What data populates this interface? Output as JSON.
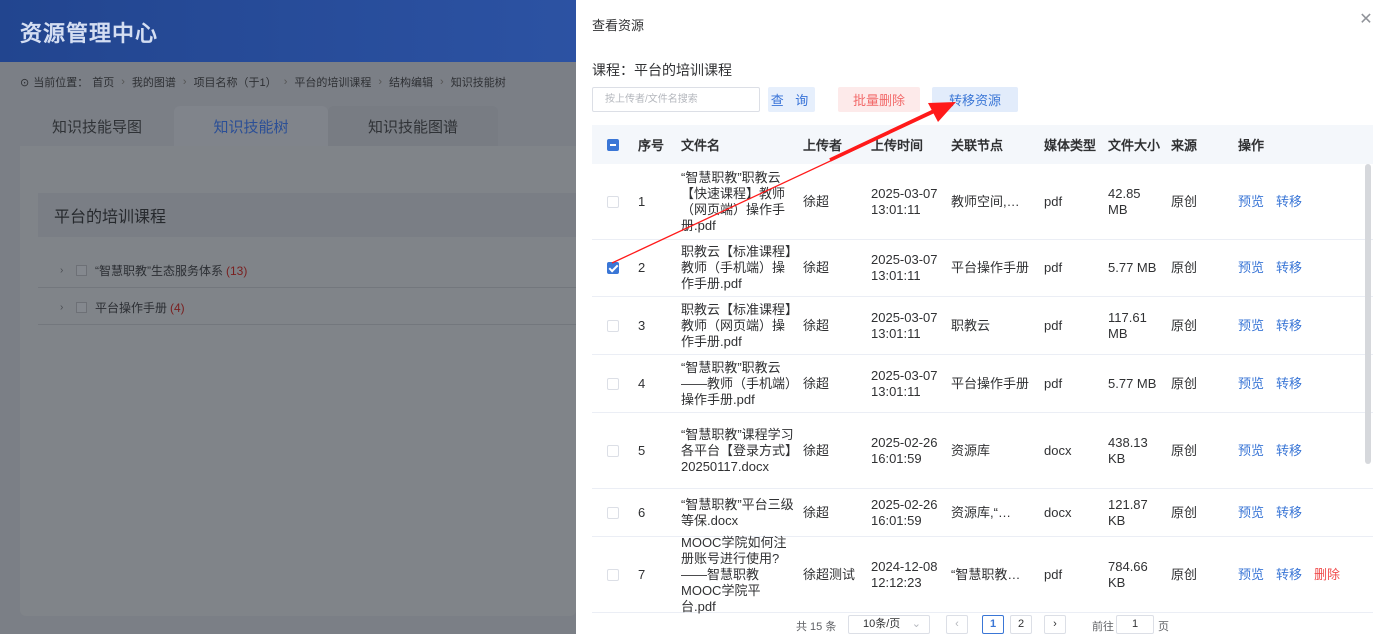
{
  "app": {
    "title": "资源管理中心"
  },
  "breadcrumb": {
    "prefix": "当前位置：",
    "items": [
      "首页",
      "我的图谱",
      "项目名称（于1）",
      "平台的培训课程",
      "结构编辑",
      "知识技能树"
    ]
  },
  "tabs": [
    {
      "label": "知识技能导图"
    },
    {
      "label": "知识技能树"
    },
    {
      "label": "知识技能图谱"
    }
  ],
  "course_panel": {
    "title": "平台的培训课程",
    "tree": [
      {
        "label": "“智慧职教”生态服务体系",
        "count": "(13)"
      },
      {
        "label": "平台操作手册",
        "count": "(4)"
      }
    ]
  },
  "drawer": {
    "title": "查看资源",
    "course_label": "课程：平台的培训课程",
    "search_placeholder": "按上传者/文件名搜索",
    "query_label": "查 询",
    "batch_delete_label": "批量删除",
    "move_label": "转移资源",
    "columns": [
      "序号",
      "文件名",
      "上传者",
      "上传时间",
      "关联节点",
      "媒体类型",
      "文件大小",
      "来源",
      "操作"
    ],
    "rows": [
      {
        "no": "1",
        "name": "“智慧职教”职教云【快速课程】教师（网页端）操作手册.pdf",
        "uploader": "徐超",
        "time": "2025-03-07 13:01:11",
        "node": "教师空间,…",
        "media": "pdf",
        "size": "42.85 MB",
        "source": "原创",
        "preview": "预览",
        "move": "转移",
        "delete": "",
        "checked": false
      },
      {
        "no": "2",
        "name": "职教云【标准课程】教师（手机端）操作手册.pdf",
        "uploader": "徐超",
        "time": "2025-03-07 13:01:11",
        "node": "平台操作手册",
        "media": "pdf",
        "size": "5.77 MB",
        "source": "原创",
        "preview": "预览",
        "move": "转移",
        "delete": "",
        "checked": true
      },
      {
        "no": "3",
        "name": "职教云【标准课程】教师（网页端）操作手册.pdf",
        "uploader": "徐超",
        "time": "2025-03-07 13:01:11",
        "node": "职教云",
        "media": "pdf",
        "size": "117.61 MB",
        "source": "原创",
        "preview": "预览",
        "move": "转移",
        "delete": "",
        "checked": false
      },
      {
        "no": "4",
        "name": "“智慧职教”职教云——教师（手机端）操作手册.pdf",
        "uploader": "徐超",
        "time": "2025-03-07 13:01:11",
        "node": "平台操作手册",
        "media": "pdf",
        "size": "5.77 MB",
        "source": "原创",
        "preview": "预览",
        "move": "转移",
        "delete": "",
        "checked": false
      },
      {
        "no": "5",
        "name": "“智慧职教”课程学习各平台【登录方式】20250117.docx",
        "uploader": "徐超",
        "time": "2025-02-26 16:01:59",
        "node": "资源库",
        "media": "docx",
        "size": "438.13 KB",
        "source": "原创",
        "preview": "预览",
        "move": "转移",
        "delete": "",
        "checked": false
      },
      {
        "no": "6",
        "name": "“智慧职教”平台三级等保.docx",
        "uploader": "徐超",
        "time": "2025-02-26 16:01:59",
        "node": "资源库,“…",
        "media": "docx",
        "size": "121.87 KB",
        "source": "原创",
        "preview": "预览",
        "move": "转移",
        "delete": "",
        "checked": false
      },
      {
        "no": "7",
        "name": "MOOC学院如何注册账号进行使用?——智慧职教MOOC学院平台.pdf",
        "uploader": "徐超测试",
        "time": "2024-12-08 12:12:23",
        "node": "“智慧职教…",
        "media": "pdf",
        "size": "784.66 KB",
        "source": "原创",
        "preview": "预览",
        "move": "转移",
        "delete": "删除",
        "checked": false
      }
    ],
    "pagination": {
      "total": "共 15 条",
      "page_size": "10条/页",
      "pages": [
        "1",
        "2"
      ],
      "current_page": "1",
      "goto_label": "前往",
      "goto_value": "1",
      "page_unit": "页"
    }
  },
  "colors": {
    "primary": "#3a76d6",
    "danger": "#f04c4c",
    "header_bg": "#22458f",
    "annotation_arrow": "#ff1a1a"
  }
}
